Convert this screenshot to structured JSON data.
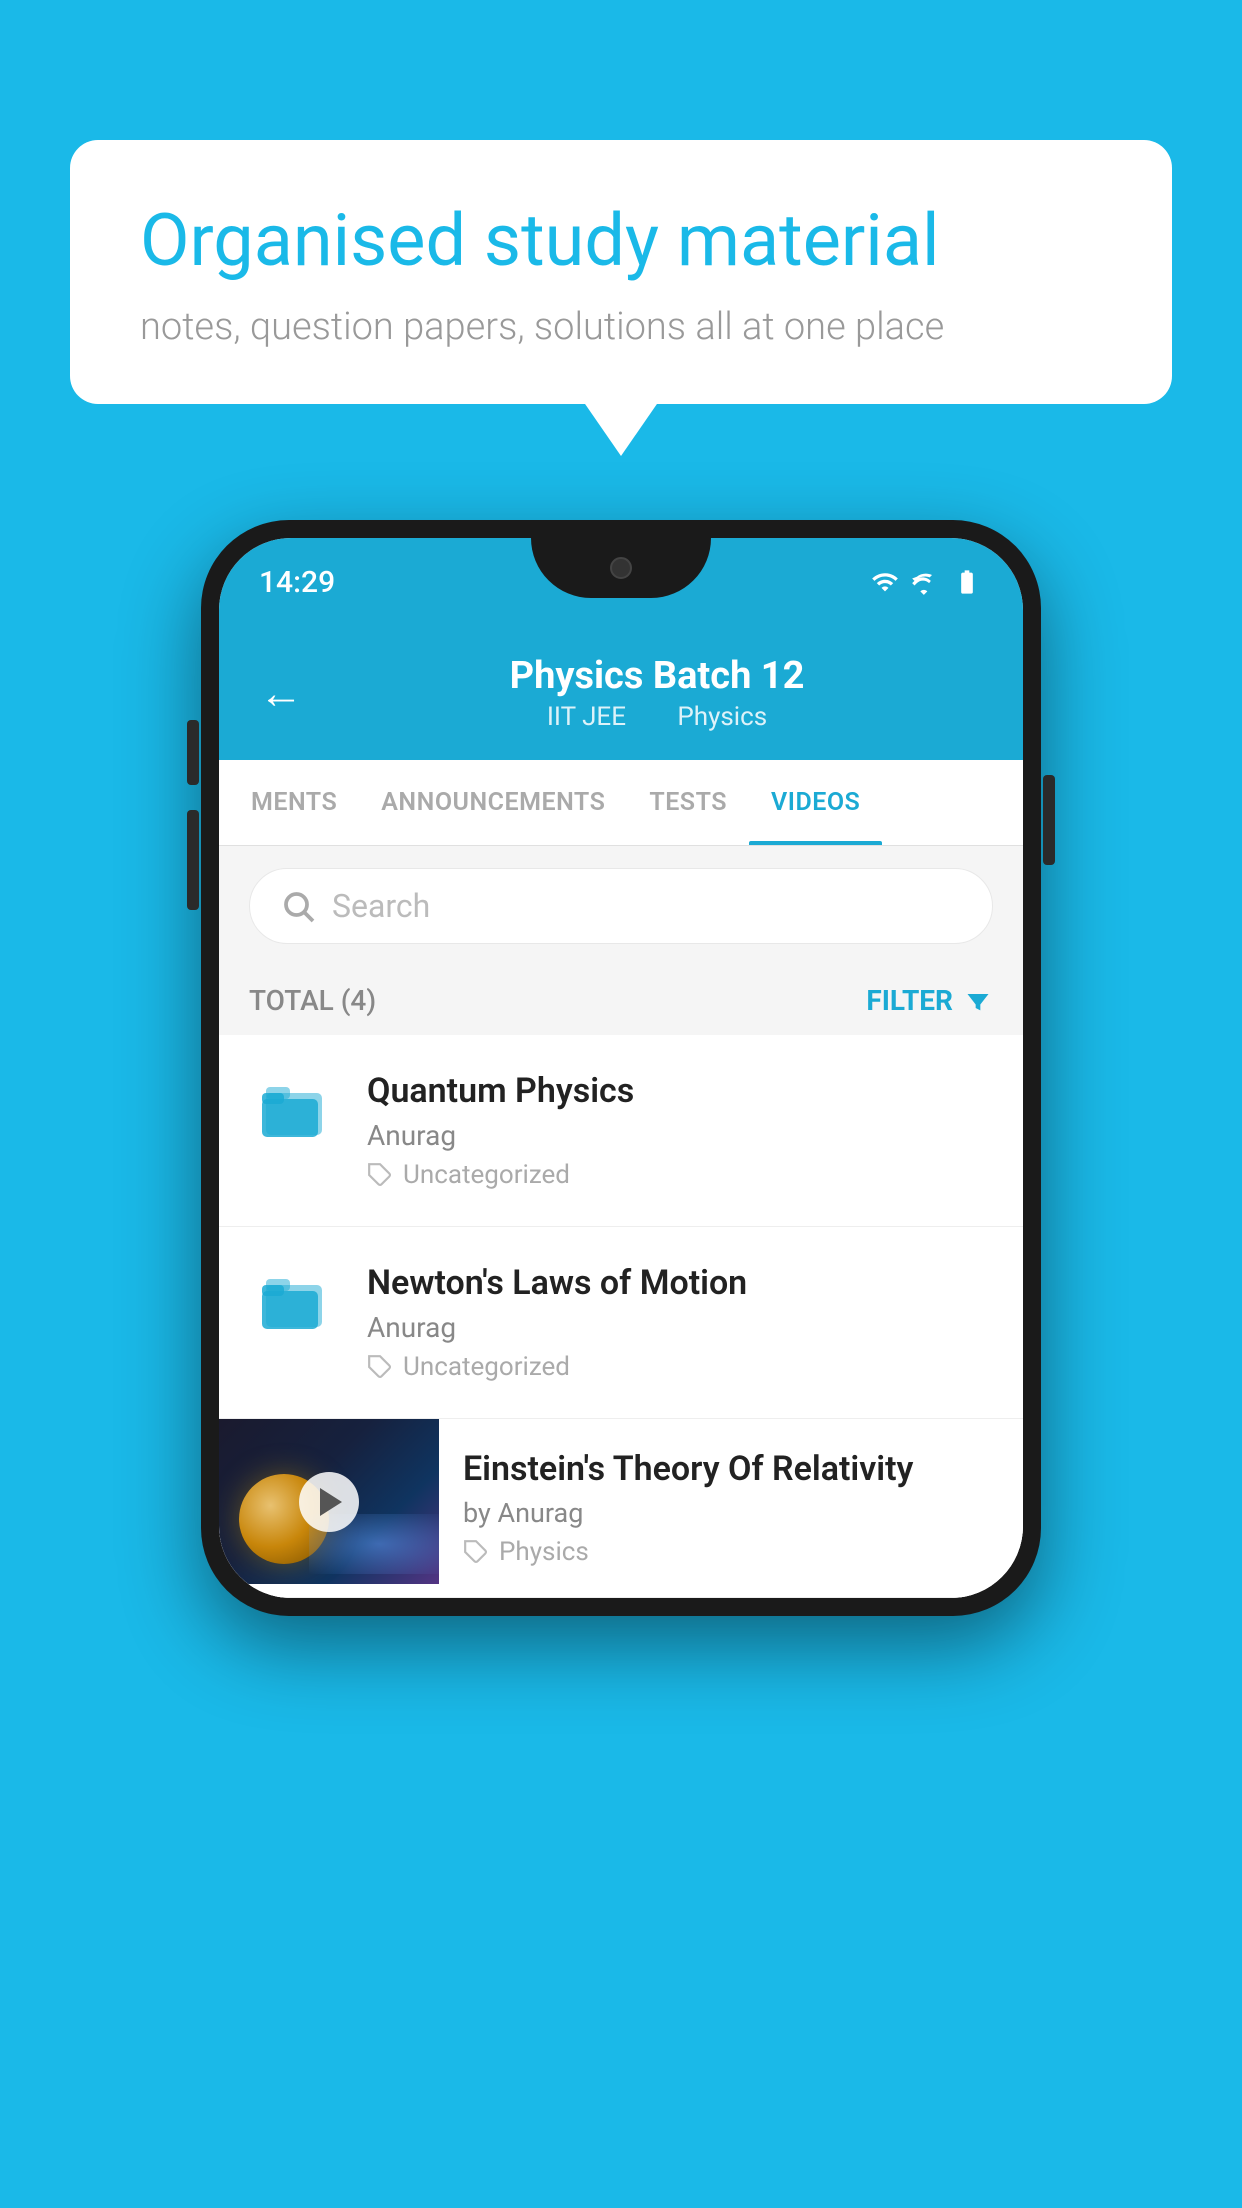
{
  "background_color": "#1ab9e8",
  "speech_bubble": {
    "title": "Organised study material",
    "subtitle": "notes, question papers, solutions all at one place"
  },
  "phone": {
    "status_bar": {
      "time": "14:29",
      "wifi": "▾",
      "signal": "▴",
      "battery": "▮"
    },
    "header": {
      "title": "Physics Batch 12",
      "subtitle_parts": [
        "IIT JEE",
        "Physics"
      ],
      "back_label": "←"
    },
    "tabs": [
      {
        "label": "MENTS",
        "active": false
      },
      {
        "label": "ANNOUNCEMENTS",
        "active": false
      },
      {
        "label": "TESTS",
        "active": false
      },
      {
        "label": "VIDEOS",
        "active": true
      }
    ],
    "search": {
      "placeholder": "Search"
    },
    "filter_bar": {
      "total_label": "TOTAL (4)",
      "filter_label": "FILTER"
    },
    "videos": [
      {
        "id": 1,
        "title": "Quantum Physics",
        "author": "Anurag",
        "tag": "Uncategorized",
        "type": "folder"
      },
      {
        "id": 2,
        "title": "Newton's Laws of Motion",
        "author": "Anurag",
        "tag": "Uncategorized",
        "type": "folder"
      },
      {
        "id": 3,
        "title": "Einstein's Theory Of Relativity",
        "author": "by Anurag",
        "tag": "Physics",
        "type": "thumbnail"
      }
    ]
  }
}
